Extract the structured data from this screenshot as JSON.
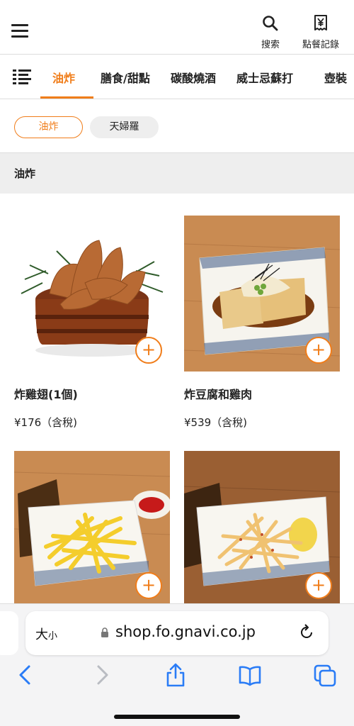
{
  "header": {
    "search_label": "搜索",
    "orders_label": "點餐記錄",
    "icons": {
      "menu": "hamburger-icon",
      "search": "search-icon",
      "orders": "receipt-yen-icon"
    }
  },
  "categories": {
    "tabs": [
      {
        "label": "油炸",
        "active": true
      },
      {
        "label": "膳食/甜點",
        "active": false
      },
      {
        "label": "碳酸燒酒",
        "active": false
      },
      {
        "label": "威士忌蘇打",
        "active": false
      },
      {
        "label": "壺裝",
        "active": false
      }
    ]
  },
  "subcategories": [
    {
      "label": "油炸",
      "active": true
    },
    {
      "label": "天婦羅",
      "active": false
    }
  ],
  "section": {
    "title": "油炸"
  },
  "products": [
    {
      "name": "炸雞翅(1個)",
      "price": "¥176（含稅)"
    },
    {
      "name": "炸豆腐和雞肉",
      "price": "¥539（含稅)"
    },
    {
      "name": "",
      "price": ""
    },
    {
      "name": "",
      "price": ""
    }
  ],
  "add_button": "+",
  "browser": {
    "text_size_label": "大",
    "text_size_small": "小",
    "url": "shop.fo.gnavi.co.jp"
  },
  "colors": {
    "accent": "#f07d1a",
    "chip_bg": "#eeeeee",
    "section_bg": "#eeeeee",
    "ios_blue": "#2a7cf6"
  }
}
